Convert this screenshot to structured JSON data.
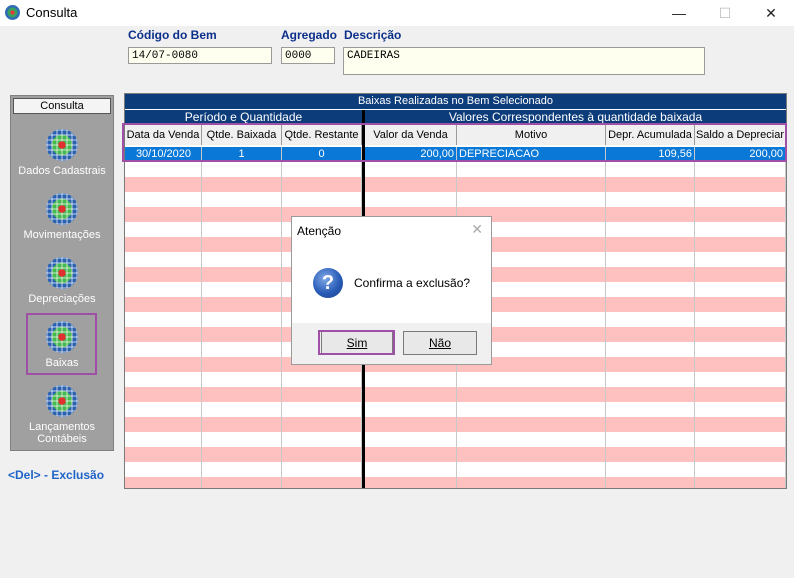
{
  "window": {
    "title": "Consulta",
    "minimize": "—",
    "maximize": "☐",
    "close": "✕"
  },
  "form": {
    "codigo_label": "Código do Bem",
    "codigo_value": "14/07-0080",
    "agregado_label": "Agregado",
    "agregado_value": "0000",
    "descricao_label": "Descrição",
    "descricao_value": "CADEIRAS"
  },
  "sidebar": {
    "header": "Consulta",
    "items": [
      {
        "label": "Dados Cadastrais",
        "icon": "globe-icon"
      },
      {
        "label": "Movimentações",
        "icon": "globe-icon"
      },
      {
        "label": "Depreciações",
        "icon": "globe-icon"
      },
      {
        "label": "Baixas",
        "icon": "globe-icon",
        "selected": true
      },
      {
        "label": "Lançamentos Contábeis",
        "icon": "globe-icon"
      }
    ],
    "hint": "<Del> - Exclusão"
  },
  "grid": {
    "title": "Baixas Realizadas no Bem Selecionado",
    "group_left": "Período e Quantidade",
    "group_right": "Valores Correspondentes à quantidade baixada",
    "columns": [
      "Data da Venda",
      "Qtde. Baixada",
      "Qtde. Restante",
      "Valor da Venda",
      "Motivo",
      "Depr. Acumulada",
      "Saldo a Depreciar"
    ],
    "rows": [
      [
        "30/10/2020",
        "1",
        "0",
        "200,00",
        "DEPRECIACAO",
        "109,56",
        "200,00"
      ]
    ],
    "colors": {
      "header_bg": "#0d3c7a",
      "selected_row": "#0a78d7",
      "stripe": "#ffc0c0"
    }
  },
  "dialog": {
    "title": "Atenção",
    "close": "✕",
    "icon": "question-icon",
    "message": "Confirma a exclusão?",
    "yes_label": "Sim",
    "no_label": "Não"
  }
}
